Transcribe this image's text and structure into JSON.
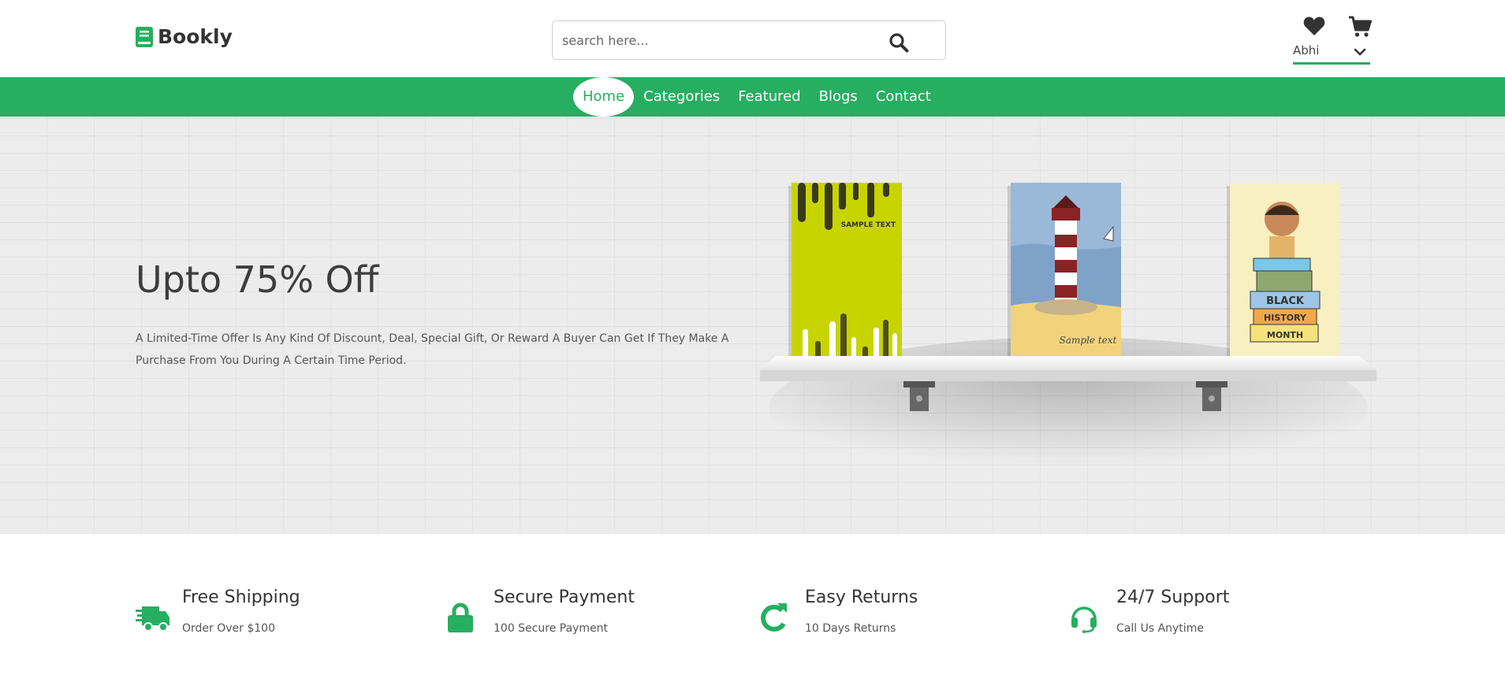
{
  "header": {
    "logo_text": "Bookly",
    "search_placeholder": "search here...",
    "user_name": "Abhi"
  },
  "nav": {
    "items": [
      {
        "label": "Home",
        "active": true
      },
      {
        "label": "Categories"
      },
      {
        "label": "Featured"
      },
      {
        "label": "Blogs"
      },
      {
        "label": "Contact"
      }
    ]
  },
  "hero": {
    "title": "Upto 75% Off",
    "description": "A Limited-Time Offer Is Any Kind Of Discount, Deal, Special Gift, Or Reward A Buyer Can Get If They Make A Purchase From You During A Certain Time Period.",
    "books": [
      {
        "cover_text": "SAMPLE TEXT"
      },
      {
        "cover_text": "Sample text"
      },
      {
        "cover_text_lines": [
          "BLACK",
          "HISTORY",
          "MONTH"
        ]
      }
    ]
  },
  "features": [
    {
      "title": "Free Shipping",
      "subtitle": "Order Over $100",
      "icon": "truck-icon"
    },
    {
      "title": "Secure Payment",
      "subtitle": "100 Secure Payment",
      "icon": "lock-icon"
    },
    {
      "title": "Easy Returns",
      "subtitle": "10 Days Returns",
      "icon": "redo-icon"
    },
    {
      "title": "24/7 Support",
      "subtitle": "Call Us Anytime",
      "icon": "headset-icon"
    }
  ],
  "colors": {
    "accent": "#27ae60",
    "text_dark": "#333333",
    "hero_bg": "#ececec"
  }
}
